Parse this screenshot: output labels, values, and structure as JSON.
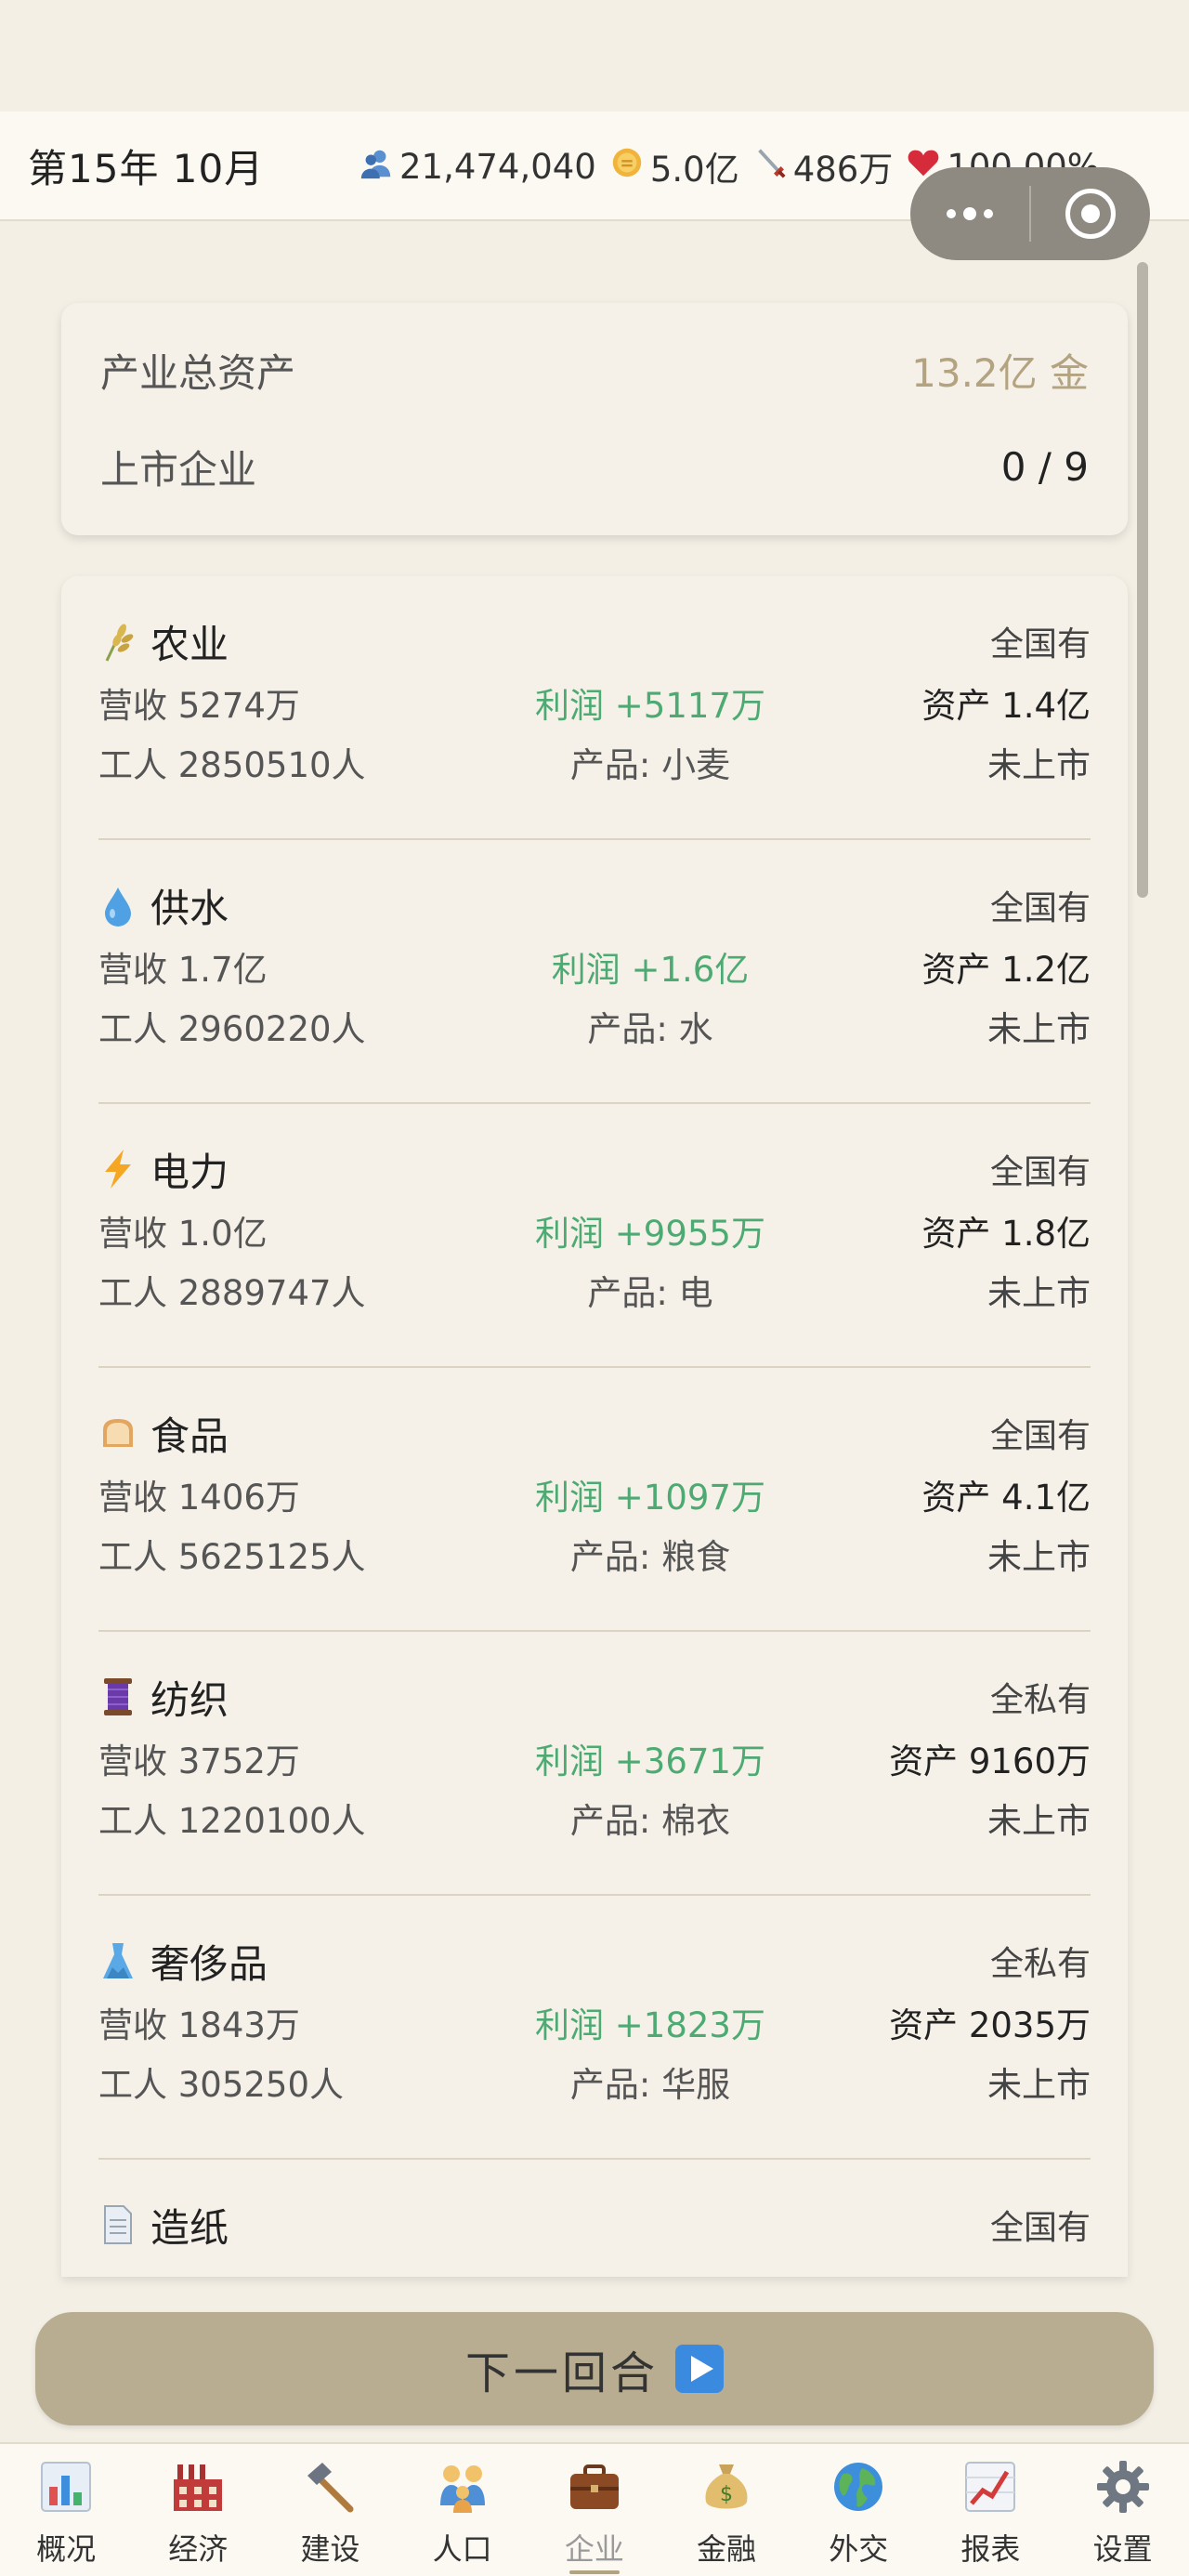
{
  "header": {
    "date": "第15年 10月",
    "population": "21,474,040",
    "gold": "5.0亿",
    "military": "486万",
    "health": "100.00%"
  },
  "summary": {
    "total_assets_label": "产业总资产",
    "total_assets_value": "13.2亿 金",
    "listed_label": "上市企业",
    "listed_value": "0 / 9"
  },
  "industries": [
    {
      "name": "农业",
      "icon": "wheat-icon",
      "ownership": "全国有",
      "revenue": "营收 5274万",
      "profit": "利润 +5117万",
      "assets": "资产 1.4亿",
      "workers": "工人 2850510人",
      "product": "产品: 小麦",
      "status": "未上市"
    },
    {
      "name": "供水",
      "icon": "water-drop-icon",
      "ownership": "全国有",
      "revenue": "营收 1.7亿",
      "profit": "利润 +1.6亿",
      "assets": "资产 1.2亿",
      "workers": "工人 2960220人",
      "product": "产品: 水",
      "status": "未上市"
    },
    {
      "name": "电力",
      "icon": "lightning-icon",
      "ownership": "全国有",
      "revenue": "营收 1.0亿",
      "profit": "利润 +9955万",
      "assets": "资产 1.8亿",
      "workers": "工人 2889747人",
      "product": "产品: 电",
      "status": "未上市"
    },
    {
      "name": "食品",
      "icon": "bread-icon",
      "ownership": "全国有",
      "revenue": "营收 1406万",
      "profit": "利润 +1097万",
      "assets": "资产 4.1亿",
      "workers": "工人 5625125人",
      "product": "产品: 粮食",
      "status": "未上市"
    },
    {
      "name": "纺织",
      "icon": "thread-spool-icon",
      "ownership": "全私有",
      "revenue": "营收 3752万",
      "profit": "利润 +3671万",
      "assets": "资产 9160万",
      "workers": "工人 1220100人",
      "product": "产品: 棉衣",
      "status": "未上市"
    },
    {
      "name": "奢侈品",
      "icon": "dress-icon",
      "ownership": "全私有",
      "revenue": "营收 1843万",
      "profit": "利润 +1823万",
      "assets": "资产 2035万",
      "workers": "工人 305250人",
      "product": "产品: 华服",
      "status": "未上市"
    },
    {
      "name": "造纸",
      "icon": "paper-icon",
      "ownership": "全国有",
      "revenue": "",
      "profit": "",
      "assets": "",
      "workers": "",
      "product": "",
      "status": ""
    }
  ],
  "next_turn": {
    "label": "下一回合"
  },
  "tabs": [
    {
      "label": "概况",
      "icon": "bar-chart-icon"
    },
    {
      "label": "经济",
      "icon": "factory-icon"
    },
    {
      "label": "建设",
      "icon": "hammer-icon"
    },
    {
      "label": "人口",
      "icon": "family-icon"
    },
    {
      "label": "企业",
      "icon": "briefcase-icon",
      "active": true
    },
    {
      "label": "金融",
      "icon": "money-bag-icon"
    },
    {
      "label": "外交",
      "icon": "globe-icon"
    },
    {
      "label": "报表",
      "icon": "trend-chart-icon"
    },
    {
      "label": "设置",
      "icon": "gear-icon"
    }
  ],
  "colors": {
    "profit": "#4daa72",
    "gold_text": "#b4a381",
    "button": "#b8ad90",
    "background": "#f3efe5"
  }
}
